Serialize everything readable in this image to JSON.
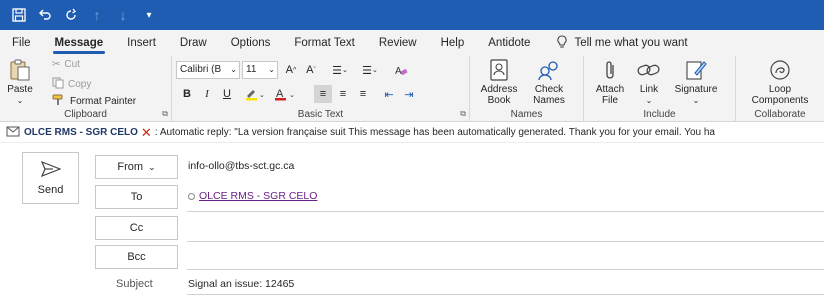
{
  "title_bar": {
    "buttons": [
      "save-icon",
      "undo-icon",
      "redo-icon",
      "up-arrow-icon",
      "down-arrow-icon",
      "customize-icon"
    ]
  },
  "tabs": [
    {
      "label": "File",
      "active": false
    },
    {
      "label": "Message",
      "active": true
    },
    {
      "label": "Insert",
      "active": false
    },
    {
      "label": "Draw",
      "active": false
    },
    {
      "label": "Options",
      "active": false
    },
    {
      "label": "Format Text",
      "active": false
    },
    {
      "label": "Review",
      "active": false
    },
    {
      "label": "Help",
      "active": false
    },
    {
      "label": "Antidote",
      "active": false
    }
  ],
  "tell_me": "Tell me what you want",
  "ribbon": {
    "clipboard": {
      "label": "Clipboard",
      "paste": "Paste",
      "cut": "Cut",
      "copy": "Copy",
      "format_painter": "Format Painter"
    },
    "basic_text": {
      "label": "Basic Text",
      "font_name": "Calibri (B",
      "font_size": "11",
      "bold": "B",
      "italic": "I",
      "underline": "U"
    },
    "names": {
      "label": "Names",
      "address_book_1": "Address",
      "address_book_2": "Book",
      "check_names_1": "Check",
      "check_names_2": "Names"
    },
    "include": {
      "label": "Include",
      "attach_1": "Attach",
      "attach_2": "File",
      "link": "Link",
      "signature": "Signature"
    },
    "collaborate": {
      "label": "Collaborate",
      "loop_1": "Loop",
      "loop_2": "Components"
    }
  },
  "info_bar": {
    "name": "OLCE RMS - SGR CELO",
    "message": ": Automatic reply: \"La version française suit  This message has been automatically generated.  Thank you for your email. You ha"
  },
  "compose": {
    "send": "Send",
    "from_label": "From",
    "from_value": "info-ollo@tbs-sct.gc.ca",
    "to_label": "To",
    "to_value": "OLCE RMS - SGR CELO",
    "cc_label": "Cc",
    "bcc_label": "Bcc",
    "subject_label": "Subject",
    "subject_value": "Signal an issue: 12465"
  },
  "colors": {
    "title_bar": "#1f5db3",
    "ribbon_bg": "#f3f3f3",
    "recipient_link": "#6b1f8a",
    "error_x": "#c42b1c"
  }
}
